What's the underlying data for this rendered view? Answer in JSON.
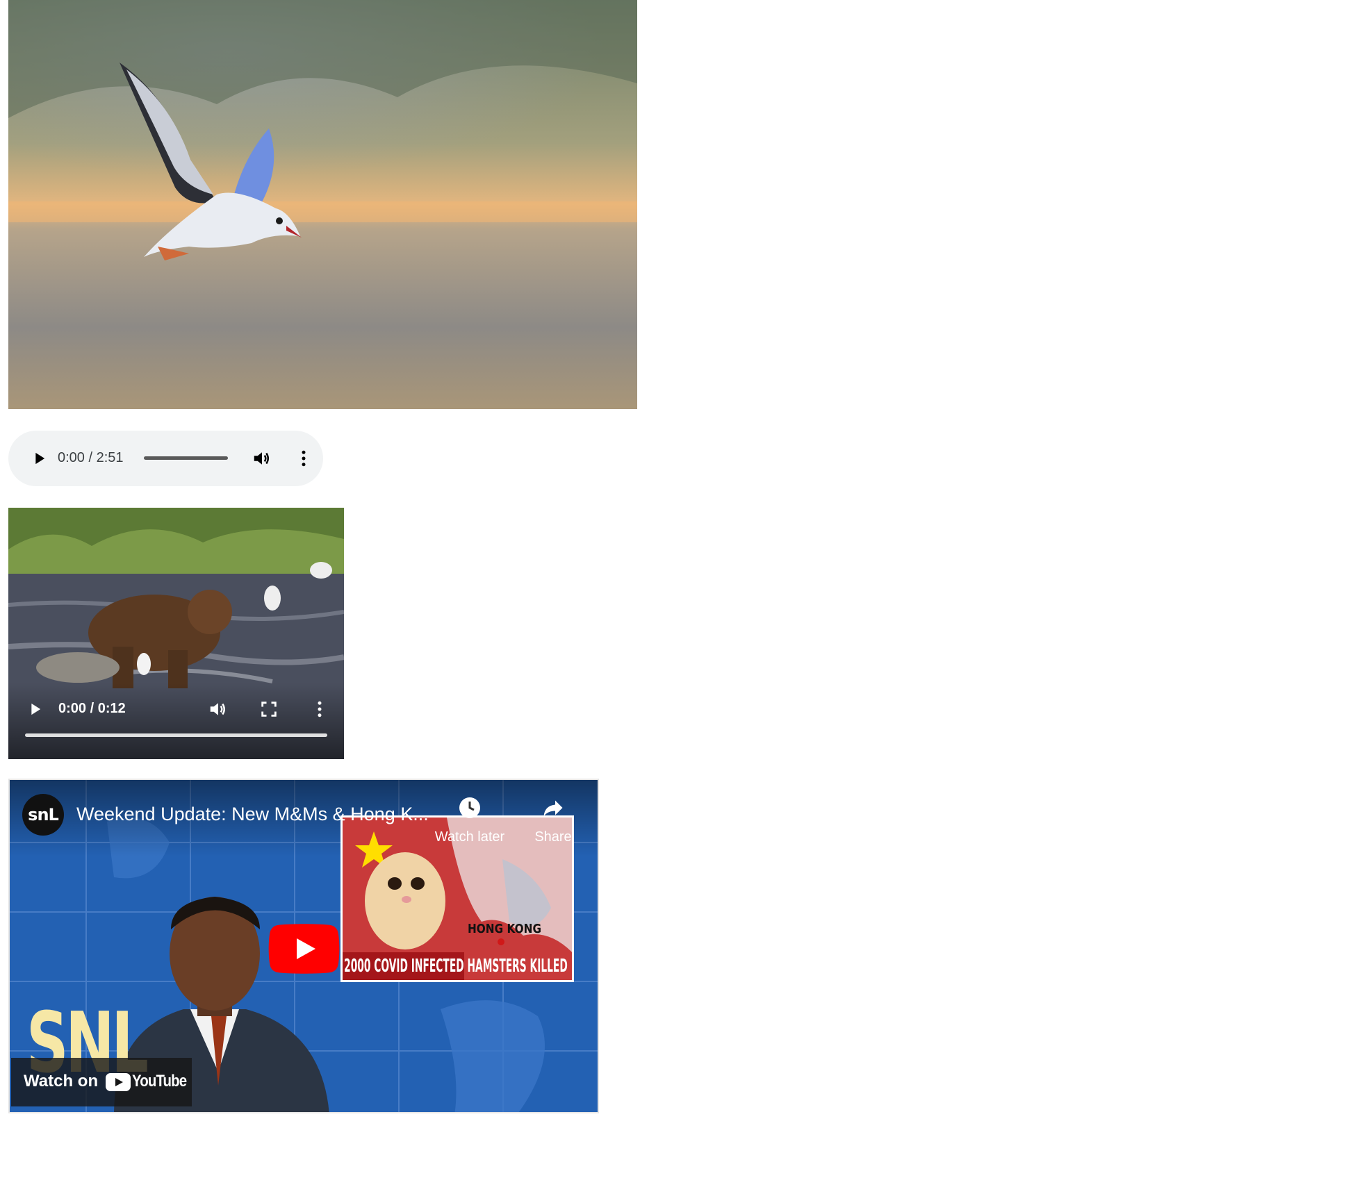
{
  "audio": {
    "time": "0:00 / 2:51",
    "state": "paused"
  },
  "video": {
    "time": "0:00 / 0:12",
    "state": "paused"
  },
  "youtube": {
    "channel_logo": "snL",
    "title": "Weekend Update: New M&Ms & Hong K...",
    "watch_later_label": "Watch later",
    "share_label": "Share",
    "thumbnail": {
      "map_label": "HONG KONG",
      "caption": "2000 COVID INFECTED HAMSTERS KILLED",
      "show_logo": "SNL"
    },
    "watch_on_label": "Watch on",
    "brand": "YouTube"
  },
  "icons": {
    "audio_play": "play-icon",
    "audio_volume": "volume-icon",
    "audio_menu": "more-vert-icon",
    "video_play": "play-icon",
    "video_volume": "volume-icon",
    "video_fullscreen": "fullscreen-icon",
    "video_menu": "more-vert-icon",
    "yt_watch_later": "clock-icon",
    "yt_share": "share-arrow-icon",
    "yt_play": "youtube-play-icon"
  },
  "colors": {
    "player_bg": "#f1f3f4",
    "player_text": "#3c4043",
    "youtube_red": "#ff0000",
    "caption_red": "#a4161a"
  }
}
